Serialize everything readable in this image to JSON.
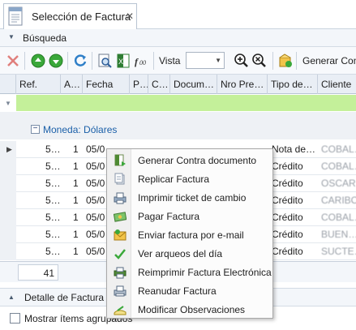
{
  "tab": {
    "title": "Selección de Factura",
    "close": "✕"
  },
  "search": {
    "label": "Búsqueda"
  },
  "toolbar": {
    "vista_label": "Vista",
    "vista_value": "",
    "generar_label": "Generar Con"
  },
  "grid": {
    "columns": [
      "Ref.",
      "A…",
      "Fecha",
      "P…",
      "C…",
      "Docum…",
      "Nro Pre…",
      "Tipo de…",
      "Cliente"
    ],
    "group_label": "Moneda: Dólares",
    "rows": [
      {
        "ref": "5…",
        "a": "1",
        "fecha": "05/0",
        "tipo": "Nota de…",
        "cliente": "COBAL…"
      },
      {
        "ref": "5…",
        "a": "1",
        "fecha": "05/0",
        "tipo": "Crédito",
        "cliente": "COBAL…"
      },
      {
        "ref": "5…",
        "a": "1",
        "fecha": "05/0",
        "tipo": "Crédito",
        "cliente": "OSCAR…"
      },
      {
        "ref": "5…",
        "a": "1",
        "fecha": "05/0",
        "tipo": "Crédito",
        "cliente": "CARIBO…"
      },
      {
        "ref": "5…",
        "a": "1",
        "fecha": "05/0",
        "tipo": "Crédito",
        "cliente": "COBAL…"
      },
      {
        "ref": "5…",
        "a": "1",
        "fecha": "05/0",
        "tipo": "Crédito",
        "cliente": "BUEN…"
      },
      {
        "ref": "5…",
        "a": "1",
        "fecha": "05/0",
        "tipo": "Crédito",
        "cliente": "SUCTE…"
      }
    ],
    "footer_count": "41"
  },
  "detail": {
    "label": "Detalle de Factura",
    "checkbox_label": "Mostrar ítems agrupados"
  },
  "context_menu": [
    {
      "label": "Generar Contra documento",
      "icon": "document-generate-icon"
    },
    {
      "label": "Replicar Factura",
      "icon": "replicate-icon"
    },
    {
      "label": "Imprimir ticket de cambio",
      "icon": "printer-ticket-icon"
    },
    {
      "label": "Pagar Factura",
      "icon": "pay-icon"
    },
    {
      "label": "Enviar factura por e-mail",
      "icon": "email-icon"
    },
    {
      "label": "Ver arqueos del día",
      "icon": "check-icon"
    },
    {
      "label": "Reimprimir Factura Electrónica",
      "icon": "reprint-icon"
    },
    {
      "label": "Reanudar Factura",
      "icon": "resume-icon"
    },
    {
      "label": "Modificar Observaciones",
      "icon": "edit-notes-icon"
    }
  ],
  "colors": {
    "filter_green": "#c4f09a",
    "group_text": "#1a5fa8",
    "delete_red": "#d9534f",
    "nav_green": "#3aa83a"
  }
}
